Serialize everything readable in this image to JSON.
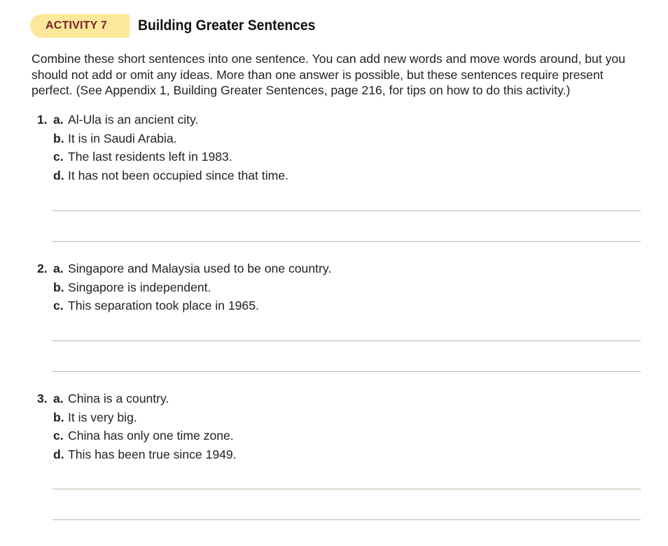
{
  "activity": {
    "badge": "ACTIVITY 7",
    "title": "Building Greater Sentences"
  },
  "instructions": "Combine these short sentences into one sentence. You can add new words and move words around, but you should not add or omit any ideas. More than one answer is possible, but these sentences require present perfect. (See Appendix 1, Building Greater Sentences, page 216, for tips on how to do this activity.)",
  "exercises": [
    {
      "number": "1.",
      "items": [
        {
          "letter": "a.",
          "text": "Al-Ula is an ancient city."
        },
        {
          "letter": "b.",
          "text": "It is in Saudi Arabia."
        },
        {
          "letter": "c.",
          "text": "The last residents left in 1983."
        },
        {
          "letter": "d.",
          "text": "It has not been occupied since that time."
        }
      ]
    },
    {
      "number": "2.",
      "items": [
        {
          "letter": "a.",
          "text": "Singapore and Malaysia used to be one country."
        },
        {
          "letter": "b.",
          "text": "Singapore is independent."
        },
        {
          "letter": "c.",
          "text": "This separation took place in 1965."
        }
      ]
    },
    {
      "number": "3.",
      "items": [
        {
          "letter": "a.",
          "text": "China is a country."
        },
        {
          "letter": "b.",
          "text": "It is very big."
        },
        {
          "letter": "c.",
          "text": "China has only one time zone."
        },
        {
          "letter": "d.",
          "text": "This has been true since 1949."
        }
      ]
    }
  ]
}
